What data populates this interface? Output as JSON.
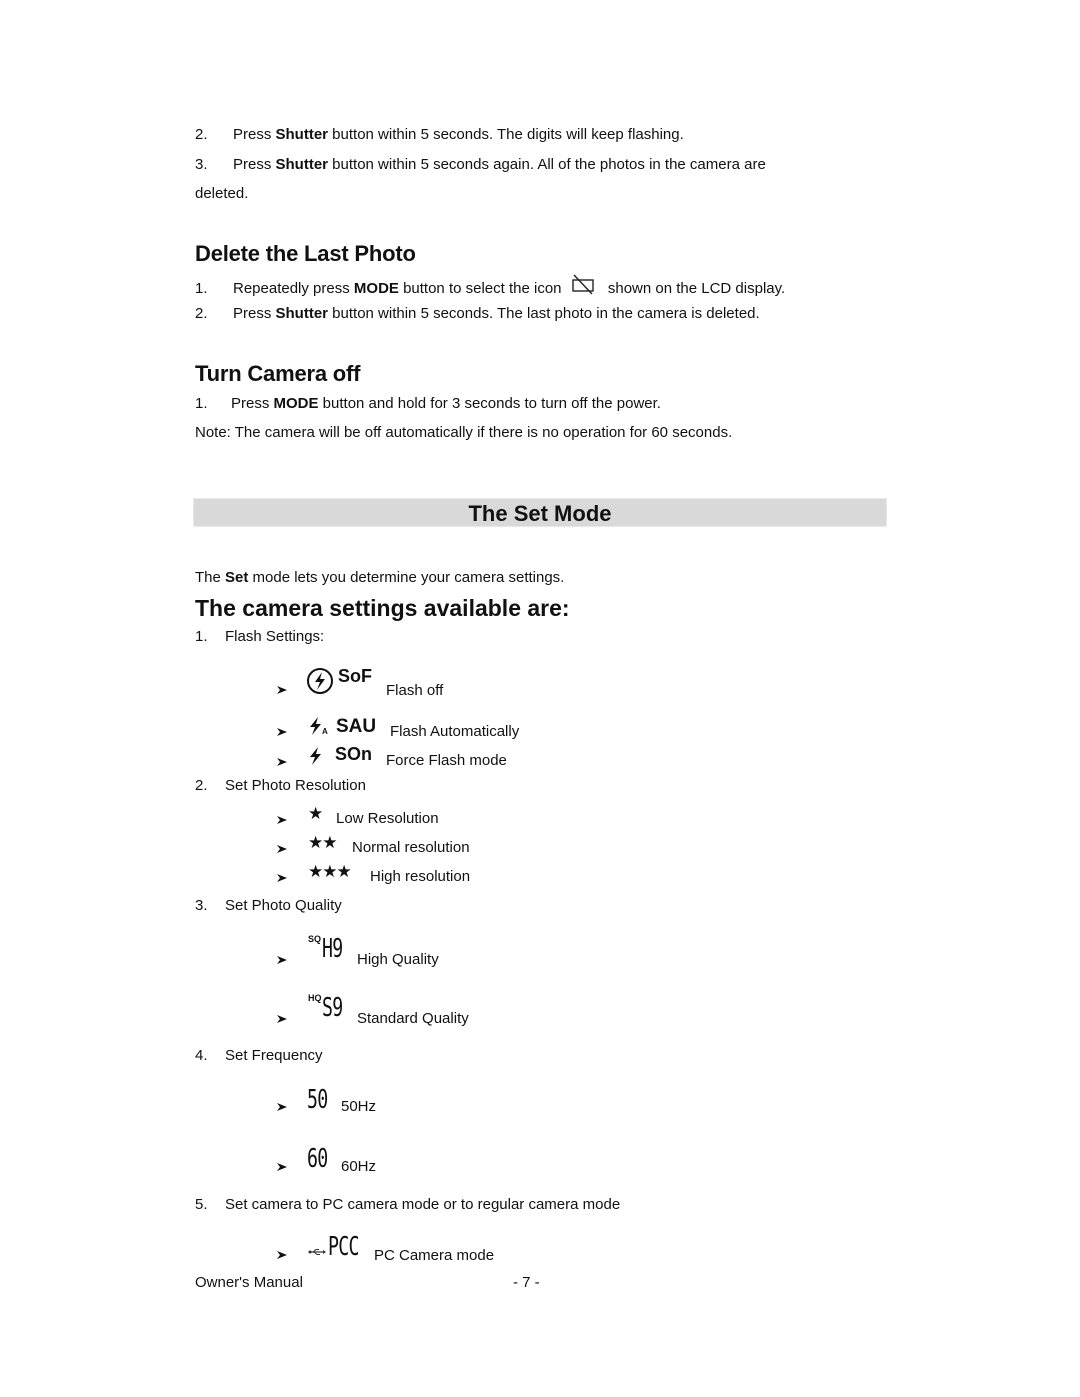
{
  "top_steps": [
    {
      "num": "2.",
      "pre": "Press ",
      "bold": "Shutter",
      "post": " button within 5 seconds. The digits will keep flashing."
    },
    {
      "num": "3.",
      "pre": "Press ",
      "bold": "Shutter",
      "post": " button within 5 seconds again. All of the photos in the camera are",
      "continuation": "deleted."
    }
  ],
  "delete_last": {
    "title": "Delete the Last Photo",
    "steps": [
      {
        "num": "1.",
        "pre": "Repeatedly press ",
        "bold": "MODE",
        "mid": " button to select the icon ",
        "icon": "delete-frame-icon",
        "post": " shown on the LCD display."
      },
      {
        "num": "2.",
        "pre": "Press ",
        "bold": "Shutter",
        "post": " button within 5 seconds. The last photo in the camera is deleted."
      }
    ]
  },
  "turn_off": {
    "title": "Turn Camera off",
    "steps": [
      {
        "num": "1.",
        "pre": "Press ",
        "bold": "MODE",
        "post": " button and hold for 3 seconds to turn off the power."
      }
    ],
    "note": "Note: The camera will be off automatically if there is no operation for 60 seconds."
  },
  "set_mode": {
    "banner": "The Set Mode",
    "intro_pre": "The ",
    "intro_bold": "Set",
    "intro_post": " mode lets you determine your camera settings.",
    "settings_title": "The camera settings available are:",
    "settings": [
      {
        "num": "1.",
        "label": "Flash Settings:",
        "options": [
          {
            "icon": "flash-off-icon",
            "code": "SoF",
            "label": "Flash off"
          },
          {
            "icon": "flash-auto-icon",
            "icon_sub": "A",
            "code": "SAU",
            "label": "Flash Automatically"
          },
          {
            "icon": "flash-force-icon",
            "code": "SOn",
            "label": "Force Flash mode"
          }
        ]
      },
      {
        "num": "2.",
        "label": "Set Photo Resolution",
        "options": [
          {
            "icon": "one-star-icon",
            "stars": "★",
            "label": "Low Resolution"
          },
          {
            "icon": "two-stars-icon",
            "stars": "★★",
            "label": "Normal resolution"
          },
          {
            "icon": "three-stars-icon",
            "stars": "★★★",
            "label": "High resolution"
          }
        ]
      },
      {
        "num": "3.",
        "label": "Set Photo Quality",
        "options": [
          {
            "icon": "high-quality-lcd-icon",
            "small": "SQ",
            "code": "H9",
            "label": "High Quality"
          },
          {
            "icon": "standard-quality-lcd-icon",
            "small": "HQ",
            "code": "S9",
            "label": "Standard Quality"
          }
        ]
      },
      {
        "num": "4.",
        "label": "Set Frequency",
        "options": [
          {
            "icon": "50hz-lcd-icon",
            "code": "50",
            "label": "50Hz"
          },
          {
            "icon": "60hz-lcd-icon",
            "code": "60",
            "label": "60Hz"
          }
        ]
      },
      {
        "num": "5.",
        "label": "Set camera to PC camera mode or to regular camera mode",
        "options": [
          {
            "icon": "usb-pc-camera-icon",
            "code": "PCC",
            "label": "PC Camera mode"
          }
        ]
      }
    ]
  },
  "footer": {
    "left": "Owner's Manual",
    "page": "- 7 -"
  }
}
